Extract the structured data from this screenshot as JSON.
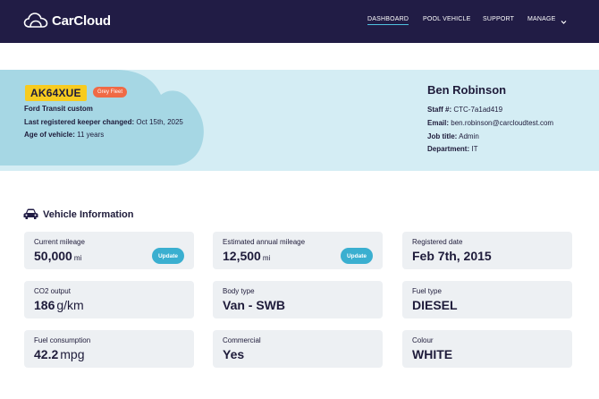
{
  "nav": {
    "brand": "CarCloud",
    "items": [
      {
        "label": "DASHBOARD"
      },
      {
        "label": "POOL VEHICLE"
      },
      {
        "label": "SUPPORT"
      },
      {
        "label": "MANAGE"
      }
    ]
  },
  "vehicle": {
    "plate": "AK64XUE",
    "fleet_badge": "Grey Fleet",
    "model": "Ford Transit custom",
    "keeper_label": "Last registered keeper changed:",
    "keeper_value": "Oct 15th, 2025",
    "age_label": "Age of vehicle:",
    "age_value": "11 years"
  },
  "person": {
    "name": "Ben Robinson",
    "staff_label": "Staff #:",
    "staff_value": "CTC-7a1ad419",
    "email_label": "Email:",
    "email_value": "ben.robinson@carcloudtest.com",
    "job_label": "Job title:",
    "job_value": "Admin",
    "dept_label": "Department:",
    "dept_value": "IT"
  },
  "section": {
    "title": "Vehicle Information"
  },
  "cards": {
    "mileage": {
      "label": "Current mileage",
      "value": "50,000",
      "unit": "mi",
      "button": "Update"
    },
    "annual": {
      "label": "Estimated annual mileage",
      "value": "12,500",
      "unit": "mi",
      "button": "Update"
    },
    "registered": {
      "label": "Registered date",
      "value": "Feb 7th, 2015"
    },
    "co2": {
      "label": "CO2 output",
      "value": "186",
      "unit": "g/km"
    },
    "body": {
      "label": "Body type",
      "value": "Van - SWB"
    },
    "fuel_type": {
      "label": "Fuel type",
      "value": "DIESEL"
    },
    "consumption": {
      "label": "Fuel consumption",
      "value": "42.2",
      "unit": "mpg"
    },
    "commercial": {
      "label": "Commercial",
      "value": "Yes"
    },
    "colour": {
      "label": "Colour",
      "value": "WHITE"
    }
  },
  "colors": {
    "nav_bg": "#211c45",
    "hero_bg": "#d4edf4",
    "cloud": "#a6d7e4",
    "plate": "#f7cb1f",
    "badge": "#f06a45",
    "accent": "#3aafd0",
    "card_bg": "#edf0f3"
  },
  "icons": [
    "cloud-logo-icon",
    "chevron-down-icon",
    "car-icon"
  ]
}
